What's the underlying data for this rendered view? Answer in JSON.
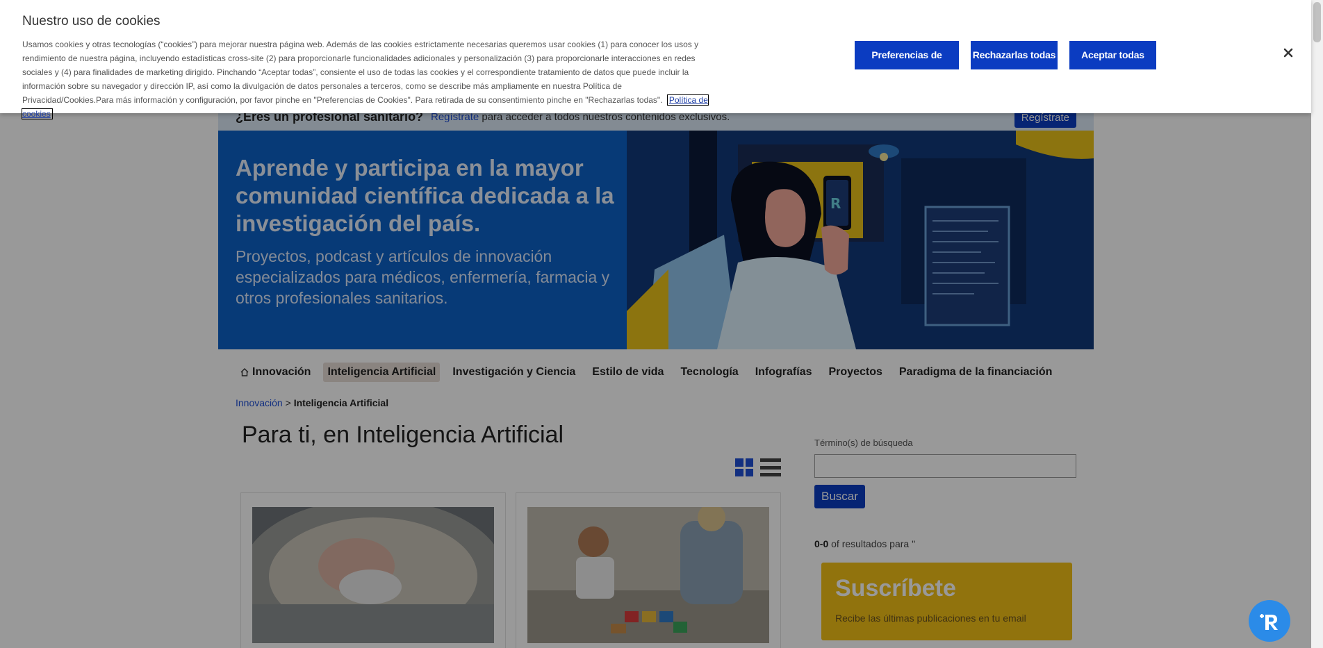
{
  "cookie_banner": {
    "title": "Nuestro uso de cookies",
    "body": "Usamos cookies y otras tecnologías (“cookies”) para mejorar nuestra página web. Además de las cookies estrictamente necesarias queremos usar cookies (1) para conocer los usos y rendimiento de nuestra página, incluyendo estadísticas cross-site (2) para proporcionarle funcionalidades adicionales y personalización (3) para proporcionarle interacciones en redes sociales y (4) para finalidades de marketing dirigido. Pinchando “Aceptar todas”, consiente el uso de todas las cookies y el correspondiente tratamiento de datos que puede incluir la información sobre su navegador y dirección IP, así como la divulgación de datos personales a terceros, como se describe más ampliamente en nuestra Política de Privacidad/Cookies.Para más información y configuración, por favor pinche en \"Preferencias de Cookies\". Para retirada de su consentimiento pinche en \"Rechazarlas todas\".",
    "policy_link": "Política de cookies",
    "buttons": {
      "preferences": "Preferencias de cookies",
      "reject": "Rechazarlas todas",
      "accept": "Aceptar todas"
    }
  },
  "pro_bar": {
    "question": "¿Eres un profesional sanitario?",
    "link": "Regístrate",
    "text": "para acceder a todos nuestros contenidos exclusivos.",
    "button": "Regístrate"
  },
  "hero": {
    "title": "Aprende y participa en la mayor comunidad científica dedicada a la investigación del país.",
    "subtitle": "Proyectos, podcast y artículos de innovación especializados para médicos, enfermería, farmacia y otros profesionales sanitarios."
  },
  "nav": {
    "items": [
      {
        "label": "Innovación",
        "icon": "home-icon"
      },
      {
        "label": "Inteligencia Artificial",
        "active": true
      },
      {
        "label": "Investigación y Ciencia"
      },
      {
        "label": "Estilo de vida"
      },
      {
        "label": "Tecnología"
      },
      {
        "label": "Infografías"
      },
      {
        "label": "Proyectos"
      },
      {
        "label": "Paradigma de la financiación"
      }
    ]
  },
  "breadcrumb": {
    "parent": "Innovación",
    "separator": ">",
    "current": "Inteligencia Artificial"
  },
  "main": {
    "title": "Para ti, en Inteligencia Artificial"
  },
  "sidebar": {
    "search_label": "Término(s) de búsqueda",
    "search_value": "",
    "search_button": "Buscar",
    "results_range": "0-0",
    "results_text": "of resultados para ''",
    "subscribe_title": "Suscríbete",
    "subscribe_text": "Recibe las últimas publicaciones en tu email"
  },
  "colors": {
    "brand_blue": "#0b3cc1",
    "hero_blue": "#0c62c6",
    "subscribe_yellow": "#f2c017"
  }
}
